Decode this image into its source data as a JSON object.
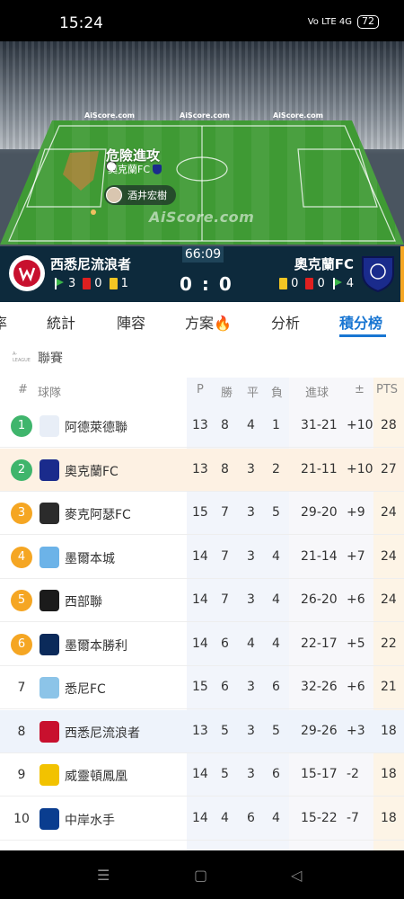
{
  "status_bar": {
    "time": "15:24",
    "signal": "Vo LTE 4G",
    "battery": "72"
  },
  "pitch": {
    "board_text": "AiScore.com",
    "watermark": "AiScore.com",
    "event_title": "危險進攻",
    "event_team": "奧克蘭FC",
    "player_name": "酒井宏樹"
  },
  "match": {
    "clock": "66:09",
    "home_name": "西悉尼流浪者",
    "away_name": "奧克蘭FC",
    "score": "0 : 0",
    "home_stats": {
      "corners": "3",
      "red": "0",
      "yellow": "1"
    },
    "away_stats": {
      "yellow": "0",
      "red": "0",
      "corners": "4"
    },
    "colors": {
      "bar": "#0d2a3c",
      "accent": "#f5a623"
    }
  },
  "tabs": [
    {
      "label": "率"
    },
    {
      "label": "統計"
    },
    {
      "label": "陣容"
    },
    {
      "label": "方案🔥"
    },
    {
      "label": "分析"
    },
    {
      "label": "積分榜",
      "active": true
    }
  ],
  "table": {
    "league_label": "聯賽",
    "league_logo_text": "A-LEAGUE",
    "headers": {
      "rank": "#",
      "team": "球隊",
      "p": "P",
      "w": "勝",
      "d": "平",
      "l": "負",
      "goals": "進球",
      "diff": "±",
      "pts": "PTS"
    },
    "rows": [
      {
        "rank": "1",
        "team": "阿德萊德聯",
        "p": "13",
        "w": "8",
        "d": "4",
        "l": "1",
        "goals": "31-21",
        "diff": "+10",
        "pts": "28",
        "badge": "#3fb56c"
      },
      {
        "rank": "2",
        "team": "奧克蘭FC",
        "p": "13",
        "w": "8",
        "d": "3",
        "l": "2",
        "goals": "21-11",
        "diff": "+10",
        "pts": "27",
        "badge": "#3fb56c"
      },
      {
        "rank": "3",
        "team": "麥克阿瑟FC",
        "p": "15",
        "w": "7",
        "d": "3",
        "l": "5",
        "goals": "29-20",
        "diff": "+9",
        "pts": "24",
        "badge": "#f5a623"
      },
      {
        "rank": "4",
        "team": "墨爾本城",
        "p": "14",
        "w": "7",
        "d": "3",
        "l": "4",
        "goals": "21-14",
        "diff": "+7",
        "pts": "24",
        "badge": "#f5a623"
      },
      {
        "rank": "5",
        "team": "西部聯",
        "p": "14",
        "w": "7",
        "d": "3",
        "l": "4",
        "goals": "26-20",
        "diff": "+6",
        "pts": "24",
        "badge": "#f5a623"
      },
      {
        "rank": "6",
        "team": "墨爾本勝利",
        "p": "14",
        "w": "6",
        "d": "4",
        "l": "4",
        "goals": "22-17",
        "diff": "+5",
        "pts": "22",
        "badge": "#f5a623"
      },
      {
        "rank": "7",
        "team": "悉尼FC",
        "p": "15",
        "w": "6",
        "d": "3",
        "l": "6",
        "goals": "32-26",
        "diff": "+6",
        "pts": "21",
        "badge": ""
      },
      {
        "rank": "8",
        "team": "西悉尼流浪者",
        "p": "13",
        "w": "5",
        "d": "3",
        "l": "5",
        "goals": "29-26",
        "diff": "+3",
        "pts": "18",
        "badge": ""
      },
      {
        "rank": "9",
        "team": "威靈頓鳳凰",
        "p": "14",
        "w": "5",
        "d": "3",
        "l": "6",
        "goals": "15-17",
        "diff": "-2",
        "pts": "18",
        "badge": ""
      },
      {
        "rank": "10",
        "team": "中岸水手",
        "p": "14",
        "w": "4",
        "d": "6",
        "l": "4",
        "goals": "15-22",
        "diff": "-7",
        "pts": "18",
        "badge": ""
      }
    ]
  },
  "nav": {
    "menu_icon": "☰",
    "home_icon": "▢",
    "back_icon": "◁"
  }
}
